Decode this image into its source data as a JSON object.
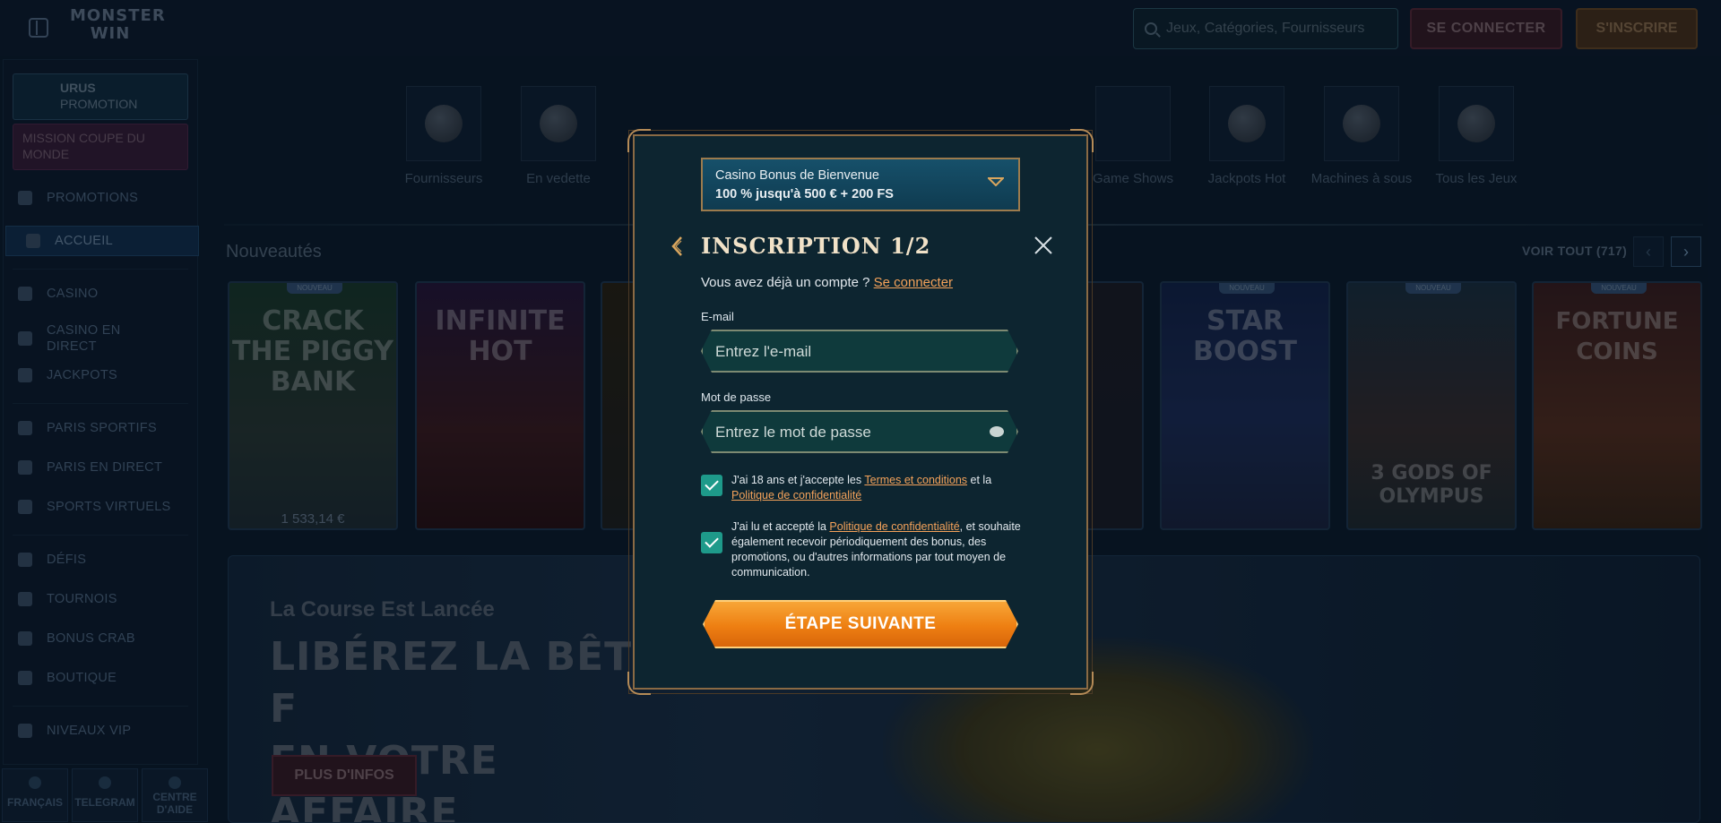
{
  "header": {
    "logo_line1": "MONSTER",
    "logo_line2": "WIN",
    "search_placeholder": "Jeux, Catégories, Fournisseurs",
    "login_label": "SE CONNECTER",
    "signup_label": "S'INSCRIRE"
  },
  "sidebar": {
    "promo_urus_title": "URUS",
    "promo_urus_sub": "PROMOTION",
    "promo_mission": "MISSION COUPE DU MONDE",
    "items": [
      {
        "label": "PROMOTIONS"
      },
      {
        "label": "ACCUEIL"
      },
      {
        "label": "CASINO"
      },
      {
        "label": "CASINO EN DIRECT"
      },
      {
        "label": "JACKPOTS"
      },
      {
        "label": "PARIS SPORTIFS"
      },
      {
        "label": "PARIS EN DIRECT"
      },
      {
        "label": "SPORTS VIRTUELS"
      },
      {
        "label": "DÉFIS"
      },
      {
        "label": "TOURNOIS"
      },
      {
        "label": "BONUS CRAB"
      },
      {
        "label": "BOUTIQUE"
      },
      {
        "label": "NIVEAUX VIP"
      }
    ],
    "footer": {
      "language": "FRANÇAIS",
      "telegram": "TELEGRAM",
      "help": "CENTRE D'AIDE"
    }
  },
  "categories": [
    {
      "label": "Fournisseurs"
    },
    {
      "label": "En vedette"
    },
    {
      "label": "Game Shows"
    },
    {
      "label": "Jackpots Hot"
    },
    {
      "label": "Machines à sous"
    },
    {
      "label": "Tous les Jeux"
    }
  ],
  "section": {
    "title": "Nouveautés",
    "see_all": "VOIR TOUT (717)"
  },
  "games": [
    {
      "title": "CRACK THE PIGGY BANK",
      "tag": "NOUVEAU",
      "price": "1 533,14 €"
    },
    {
      "title": "INFINITE HOT",
      "tag": "",
      "price": ""
    },
    {
      "title": "STAR BOOST",
      "tag": "NOUVEAU",
      "price": ""
    },
    {
      "title": "3 GODS OF OLYMPUS",
      "tag": "NOUVEAU",
      "price": ""
    },
    {
      "title": "FORTUNE COINS",
      "tag": "NOUVEAU",
      "price": ""
    }
  ],
  "banner": {
    "subtitle": "La Course Est Lancée",
    "title_line1": "LIBÉREZ LA BÊTE F",
    "title_line2": "EN VOTRE AFFAIRE",
    "cta": "PLUS D'INFOS"
  },
  "modal": {
    "bonus_line1": "Casino Bonus de Bienvenue",
    "bonus_line2": "100 % jusqu'à 500 € + 200 FS",
    "title": "INSCRIPTION 1/2",
    "have_account": "Vous avez déjà un compte ?",
    "login_link": "Se connecter",
    "email_label": "E-mail",
    "email_placeholder": "Entrez l'e-mail",
    "password_label": "Mot de passe",
    "password_placeholder": "Entrez le mot de passe",
    "terms_pre": "J'ai 18 ans et j'accepte les",
    "terms_link": "Termes et conditions",
    "terms_mid": "et la",
    "privacy_link": "Politique de confidentialité",
    "marketing_pre": "J'ai lu et accepté la",
    "marketing_link": "Politique de confidentialité",
    "marketing_post": ", et souhaite également recevoir périodiquement des bonus, des promotions, ou d'autres informations par tout moyen de communication.",
    "next_label": "ÉTAPE SUIVANTE"
  },
  "colors": {
    "accent": "#f4a25a",
    "modal_bg": "#0d2530",
    "check": "#1e9a8a",
    "cta": "#ee7f12"
  }
}
